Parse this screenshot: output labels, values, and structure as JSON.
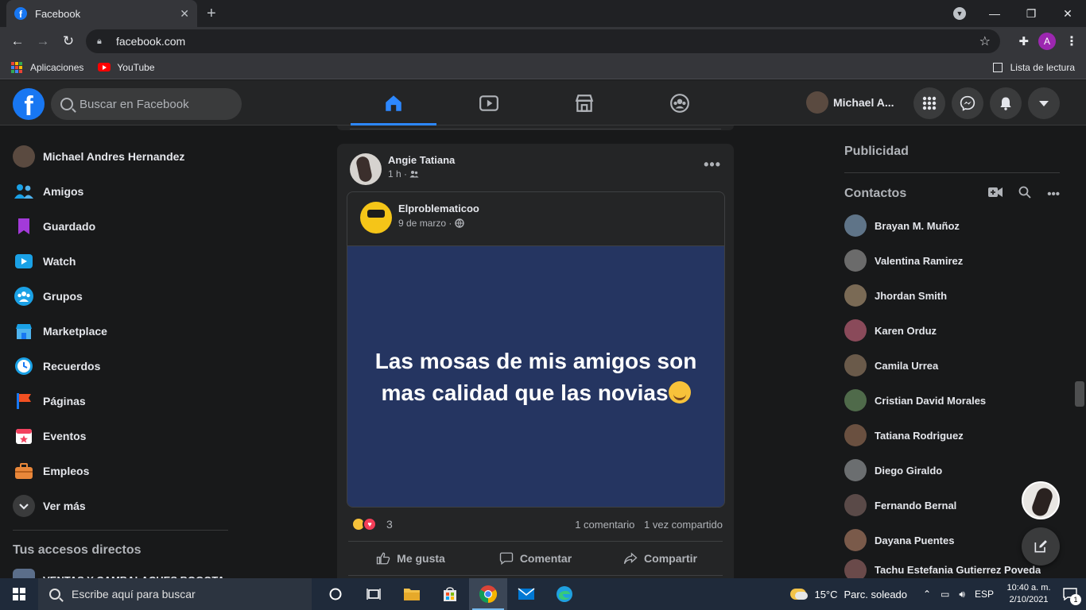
{
  "browser": {
    "tab_title": "Facebook",
    "url": "facebook.com",
    "profile_initial": "A",
    "bookmarks": [
      {
        "label": "Aplicaciones"
      },
      {
        "label": "YouTube"
      }
    ],
    "reading_list_label": "Lista de lectura"
  },
  "header": {
    "search_placeholder": "Buscar en Facebook",
    "user_name": "Michael A...",
    "active_tab": "home",
    "colors": {
      "brand": "#1877f2",
      "active": "#2d88ff"
    }
  },
  "left_nav": {
    "items": [
      {
        "label": "Michael Andres Hernandez",
        "icon": "profile-avatar"
      },
      {
        "label": "Amigos",
        "icon": "friends-icon"
      },
      {
        "label": "Guardado",
        "icon": "bookmark-icon"
      },
      {
        "label": "Watch",
        "icon": "watch-icon"
      },
      {
        "label": "Grupos",
        "icon": "groups-icon"
      },
      {
        "label": "Marketplace",
        "icon": "marketplace-icon"
      },
      {
        "label": "Recuerdos",
        "icon": "memories-icon"
      },
      {
        "label": "Páginas",
        "icon": "pages-flag-icon"
      },
      {
        "label": "Eventos",
        "icon": "events-icon"
      },
      {
        "label": "Empleos",
        "icon": "jobs-icon"
      },
      {
        "label": "Ver más",
        "icon": "chevron-down-icon"
      }
    ],
    "shortcuts_title": "Tus accesos directos",
    "shortcut_first": "VENTAS Y CAMBALACHES BOGOTA"
  },
  "post": {
    "author": "Angie Tatiana",
    "time": "1 h ·",
    "shared": {
      "author": "Elproblematicoo",
      "date": "9 de marzo ·",
      "text": "Las mosas de mis amigos son mas calidad que las novias",
      "background": "#253561"
    },
    "reaction_count": "3",
    "comments": "1 comentario",
    "shares": "1 vez compartido",
    "actions": {
      "like": "Me gusta",
      "comment": "Comentar",
      "share": "Compartir"
    }
  },
  "right": {
    "ads_title": "Publicidad",
    "contacts_title": "Contactos",
    "contacts": [
      {
        "name": "Brayan M. Muñoz",
        "color": "#5f7488"
      },
      {
        "name": "Valentina Ramirez",
        "color": "#6b6b6b"
      },
      {
        "name": "Jhordan Smith",
        "color": "#7a6a55"
      },
      {
        "name": "Karen Orduz",
        "color": "#8a4a5a"
      },
      {
        "name": "Camila Urrea",
        "color": "#6a5a4a"
      },
      {
        "name": "Cristian David Morales",
        "color": "#4f6a4a"
      },
      {
        "name": "Tatiana Rodriguez",
        "color": "#6a5040"
      },
      {
        "name": "Diego Giraldo",
        "color": "#6b6e70"
      },
      {
        "name": "Fernando Bernal",
        "color": "#5a4a48"
      },
      {
        "name": "Dayana Puentes",
        "color": "#7a5a4a"
      },
      {
        "name": "Tachu Estefania Gutierrez Poveda",
        "color": "#6a4a4a"
      }
    ]
  },
  "taskbar": {
    "search_text": "Escribe aquí para buscar",
    "temperature": "15°C",
    "weather": "Parc. soleado",
    "language": "ESP",
    "time": "10:40 a. m.",
    "date": "2/10/2021",
    "notification_count": "1"
  }
}
